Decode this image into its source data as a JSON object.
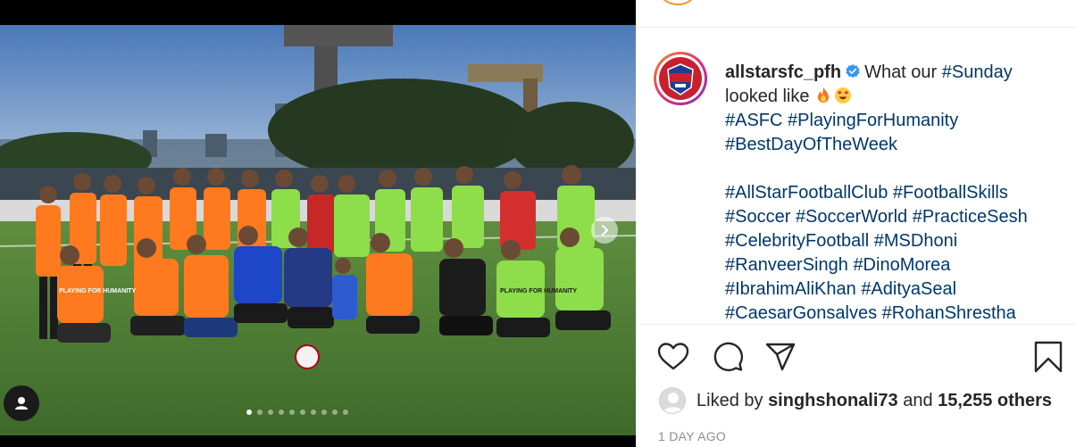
{
  "post": {
    "username": "allstarsfc_pfh",
    "caption_intro": "What our ",
    "caption_sunday": "#Sunday",
    "caption_looked": "looked like ",
    "hashtags_line1": [
      "#ASFC",
      "#PlayingForHumanity"
    ],
    "hashtags_line2": [
      "#BestDayOfTheWeek"
    ],
    "hashtags_block": [
      [
        "#AllStarFootballClub",
        "#FootballSkills"
      ],
      [
        "#Soccer",
        "#SoccerWorld",
        "#PracticeSesh"
      ],
      [
        "#CelebrityFootball",
        "#MSDhoni"
      ],
      [
        "#RanveerSingh",
        "#DinoMorea"
      ],
      [
        "#IbrahimAliKhan",
        "#AdityaSeal"
      ],
      [
        "#CaesarGonsalves",
        "#RohanShrestha"
      ]
    ],
    "liked_by_prefix": "Liked by ",
    "liked_by_user": "singhshonali73",
    "liked_by_and": " and ",
    "liked_by_others": "15,255 others",
    "timestamp": "1 DAY AGO"
  },
  "photo": {
    "bib_text_1": "PLAYING FOR HUMANITY",
    "bib_text_2": "PLAYING FOR HUMANITY",
    "carousel_count": 10,
    "carousel_active_index": 0
  },
  "icons": {
    "like": "heart-icon",
    "comment": "comment-icon",
    "share": "paper-plane-icon",
    "save": "bookmark-icon",
    "verified": "verified-badge-icon",
    "tag": "user-tag-icon",
    "next": "chevron-right-icon",
    "emoji_1": "fire-emoji-icon",
    "emoji_2": "heart-eyes-emoji-icon"
  },
  "colors": {
    "hashtag": "#00376b",
    "text": "#262626",
    "muted": "#8e8e8e",
    "verified": "#3897f0"
  }
}
